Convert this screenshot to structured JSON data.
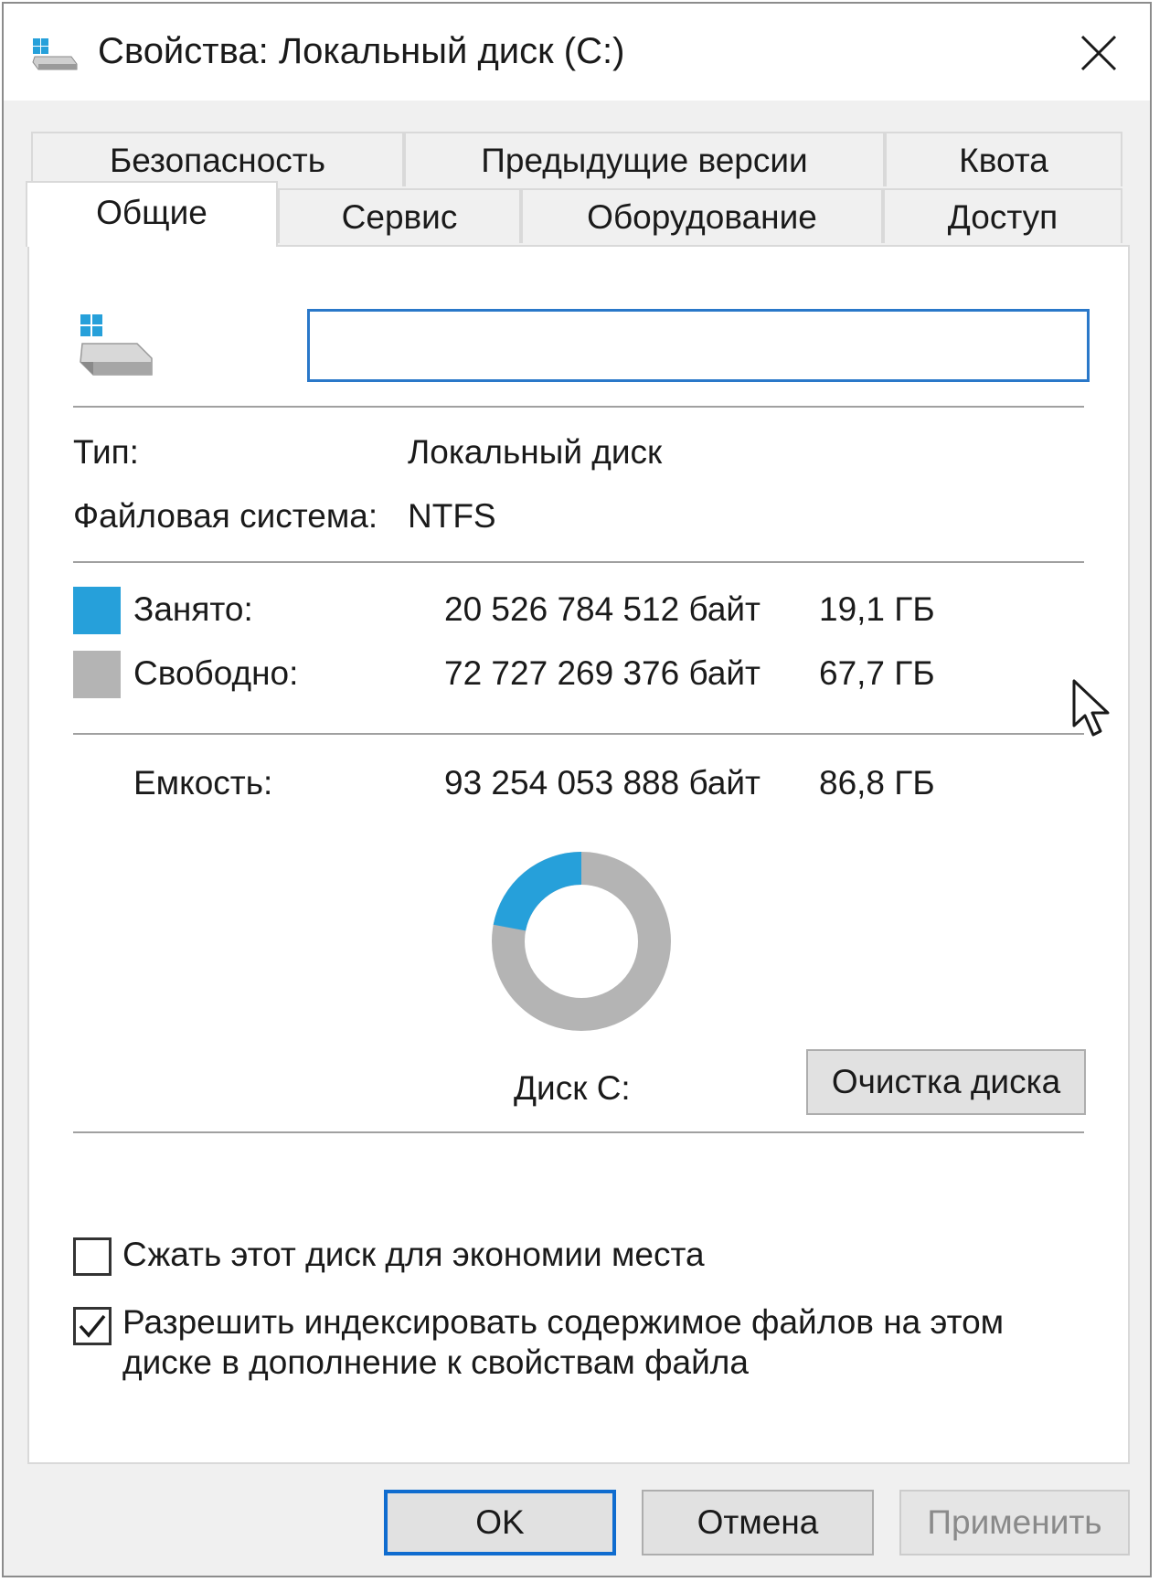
{
  "window": {
    "title": "Свойства: Локальный диск (C:)",
    "title_icon": "drive-icon",
    "close_icon": "close-icon"
  },
  "tabs": {
    "back_row": [
      {
        "label": "Безопасность"
      },
      {
        "label": "Предыдущие версии"
      },
      {
        "label": "Квота"
      }
    ],
    "front_row": [
      {
        "label": "Общие",
        "active": true
      },
      {
        "label": "Сервис"
      },
      {
        "label": "Оборудование"
      },
      {
        "label": "Доступ"
      }
    ]
  },
  "general": {
    "drive_label_value": "",
    "type_label": "Тип:",
    "type_value": "Локальный диск",
    "fs_label": "Файловая система:",
    "fs_value": "NTFS",
    "used": {
      "label": "Занято:",
      "bytes": "20 526 784 512 байт",
      "size": "19,1 ГБ",
      "color": "#26a0da"
    },
    "free": {
      "label": "Свободно:",
      "bytes": "72 727 269 376 байт",
      "size": "67,7 ГБ",
      "color": "#b4b4b4"
    },
    "capacity": {
      "label": "Емкость:",
      "bytes": "93 254 053 888 байт",
      "size": "86,8 ГБ"
    },
    "used_fraction": 0.2201,
    "drive_caption": "Диск C:",
    "cleanup_button": "Очистка диска",
    "compress_checkbox": {
      "label": "Сжать этот диск для экономии места",
      "checked": false
    },
    "index_checkbox": {
      "label_line1": "Разрешить индексировать содержимое файлов на этом",
      "label_line2": "диске в дополнение к свойствам файла",
      "checked": true
    }
  },
  "buttons": {
    "ok": "OK",
    "cancel": "Отмена",
    "apply": "Применить",
    "apply_enabled": false
  },
  "colors": {
    "accent": "#0f6ccf",
    "used": "#26a0da",
    "free": "#b4b4b4"
  }
}
